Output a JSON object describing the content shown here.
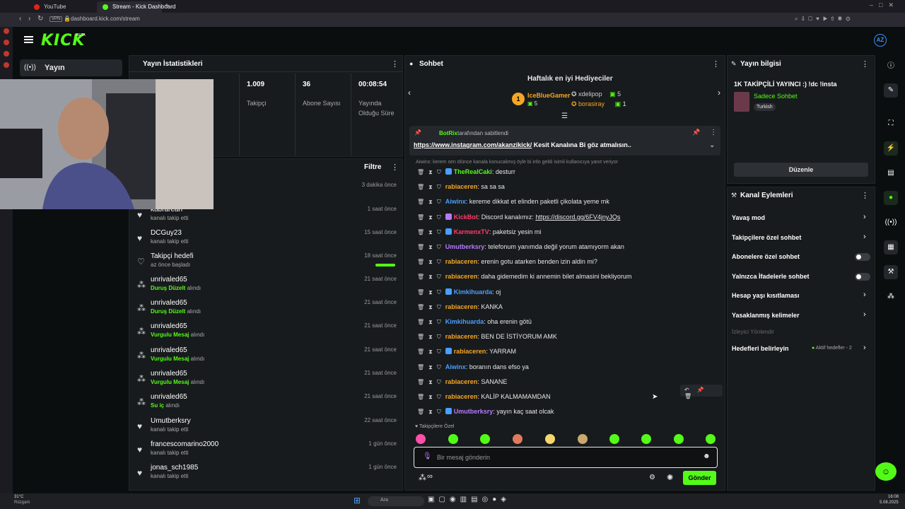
{
  "browser": {
    "tabs": [
      {
        "label": "YouTube",
        "active": false
      },
      {
        "label": "Stream - Kick Dashboard",
        "active": true
      }
    ],
    "url": "dashboard.kick.com/stream",
    "vpn_label": "VPN"
  },
  "header": {
    "logo": "KICK",
    "logo_badge": "BETA",
    "user_initials": "AZ"
  },
  "nav": {
    "items": [
      {
        "label": "Yayın",
        "icon": "broadcast-icon"
      }
    ]
  },
  "stats": {
    "title": "Yayın İstatistikleri",
    "cells": [
      {
        "value": "1.009",
        "label": "Takipçi"
      },
      {
        "value": "36",
        "label": "Abone Sayısı"
      },
      {
        "value": "00:08:54",
        "label": "Yayında Olduğu Süre"
      }
    ]
  },
  "activity": {
    "filter_label": "Filtre",
    "items": [
      {
        "name": "",
        "sub": "",
        "highlight": "",
        "time": "3 dakika önce",
        "icon": "heart-icon"
      },
      {
        "name": "kubrarean",
        "sub": "kanalı takip etti",
        "highlight": "",
        "time": "1 saat önce",
        "icon": "heart-icon"
      },
      {
        "name": "DCGuy23",
        "sub": "kanalı takip etti",
        "highlight": "",
        "time": "15 saat önce",
        "icon": "heart-icon"
      },
      {
        "name": "Takipçi hedefi",
        "sub": "az önce başladı",
        "highlight": "",
        "time": "18 saat önce",
        "icon": "heart-outline-icon",
        "progress": 1.0
      },
      {
        "name": "unrivaled65",
        "sub": "alındı",
        "highlight": "Duruş Düzelt",
        "time": "21 saat önce",
        "icon": "reward-icon"
      },
      {
        "name": "unrivaled65",
        "sub": "alındı",
        "highlight": "Duruş Düzelt",
        "time": "21 saat önce",
        "icon": "reward-icon"
      },
      {
        "name": "unrivaled65",
        "sub": "alındı",
        "highlight": "Vurgulu Mesaj",
        "time": "21 saat önce",
        "icon": "reward-icon"
      },
      {
        "name": "unrivaled65",
        "sub": "alındı",
        "highlight": "Vurgulu Mesaj",
        "time": "21 saat önce",
        "icon": "reward-icon"
      },
      {
        "name": "unrivaled65",
        "sub": "alındı",
        "highlight": "Vurgulu Mesaj",
        "time": "21 saat önce",
        "icon": "reward-icon"
      },
      {
        "name": "unrivaled65",
        "sub": "alındı",
        "highlight": "Su iç",
        "time": "21 saat önce",
        "icon": "reward-icon"
      },
      {
        "name": "Umutberksry",
        "sub": "kanalı takip etti",
        "highlight": "",
        "time": "22 saat önce",
        "icon": "heart-icon"
      },
      {
        "name": "francescomarino2000",
        "sub": "kanalı takip etti",
        "highlight": "",
        "time": "1 gün önce",
        "icon": "heart-icon"
      },
      {
        "name": "jonas_sch1985",
        "sub": "kanalı takip etti",
        "highlight": "",
        "time": "1 gün önce",
        "icon": "heart-icon"
      }
    ]
  },
  "chat": {
    "title": "Sohbet",
    "gifters": {
      "title": "Haftalık en iyi Hediyeciler",
      "first": {
        "name": "IceBlueGamer",
        "count": "5"
      },
      "others": [
        {
          "name": "xdelipop",
          "count": "5"
        },
        {
          "name": "borasiray",
          "count": "1"
        }
      ]
    },
    "pinned": {
      "by_name": "BotRix",
      "by_text": "tarafından sabitlendi",
      "link": "https://www.instagram.com/akanzikick/",
      "text": " Kesit Kanalına Bi göz atmalısın.."
    },
    "notice": "Aiwinx: kerem sen ölünce kanala konucakmış öyle bi info geldi isimli kullanıcıya yanıt veriyor",
    "messages": [
      {
        "user": "TheRealCaki",
        "color": "#53fc18",
        "text": ": desturr"
      },
      {
        "user": "rabiaceren",
        "color": "#f5a623",
        "text": ": sa sa sa"
      },
      {
        "user": "Aiwinx",
        "color": "#4a9eff",
        "text": ": kereme dikkat et elinden paketli çikolata yeme mk"
      },
      {
        "user": "KickBot",
        "color": "#ff3b6b",
        "text": ": Discord kanalımız: ",
        "link": "https://discord.gg/6FV4jnyJQs"
      },
      {
        "user": "KarmenxTV",
        "color": "#ff3b6b",
        "text": ": paketsiz yesin mi"
      },
      {
        "user": "Umutberksry",
        "color": "#b57bff",
        "text": ": telefonum yanımda değil yorum atamıyorm akan"
      },
      {
        "user": "rabiaceren",
        "color": "#f5a623",
        "text": ": erenin gotu atarken benden izin aldin mi?"
      },
      {
        "user": "rabiaceren",
        "color": "#f5a623",
        "text": ": daha gidemedim ki annemin bilet almasini bekliyorum"
      },
      {
        "user": "Kimkihuarda",
        "color": "#4a9eff",
        "text": ": oj"
      },
      {
        "user": "rabiaceren",
        "color": "#f5a623",
        "text": ": KANKA"
      },
      {
        "user": "Kimkihuarda",
        "color": "#4a9eff",
        "text": ": oha erenin götü"
      },
      {
        "user": "rabiaceren",
        "color": "#f5a623",
        "text": ": BEN DE İSTİYORUM AMK"
      },
      {
        "user": "rabiaceren",
        "color": "#f5a623",
        "text": ": YARRAM"
      },
      {
        "user": "Aiwinx",
        "color": "#4a9eff",
        "text": ": boranın dans efso ya"
      },
      {
        "user": "rabiaceren",
        "color": "#f5a623",
        "text": ": SANANE"
      },
      {
        "user": "rabiaceren",
        "color": "#f5a623",
        "text": ": KALİP KALMAMAMDAN"
      },
      {
        "user": "Umutberksry",
        "color": "#b57bff",
        "text": ": yayın kaç saat olcak"
      }
    ],
    "emote_section": "Takipçilere Özel",
    "input_placeholder": "Bir mesaj gönderin",
    "send_label": "Gönder",
    "infinity": "∞"
  },
  "info": {
    "title": "Yayın bilgisi",
    "stream_title": "1K TAKİPÇİLİ YAYINCI :) !dc !insta",
    "category": "Sadece Sohbet",
    "tag": "Turkish",
    "edit_label": "Düzenle"
  },
  "actions": {
    "title": "Kanal Eylemleri",
    "items": [
      {
        "label": "Yavaş mod",
        "control": "chevron"
      },
      {
        "label": "Takipçilere özel sohbet",
        "control": "chevron"
      },
      {
        "label": "Abonelere özel sohbet",
        "control": "toggle",
        "on": false
      },
      {
        "label": "Yalnızca İfadelerle sohbet",
        "control": "toggle",
        "on": false
      },
      {
        "label": "Hesap yaşı kısıtlaması",
        "control": "chevron"
      },
      {
        "label": "Yasaklanmış kelimeler",
        "control": "chevron"
      }
    ],
    "disabled_item": "İzleyici Yönlendir",
    "goals": {
      "label": "Hedefleri belirleyin",
      "status": "Aktif hedefler - 2"
    }
  },
  "taskbar": {
    "weather_temp": "31°C",
    "weather_label": "Rüzgarlı",
    "search": "Ara",
    "time": "16:08",
    "date": "5.08.2025"
  },
  "colors": {
    "accent": "#53fc18",
    "panel": "#181b1d",
    "bg": "#0b0e0f"
  }
}
